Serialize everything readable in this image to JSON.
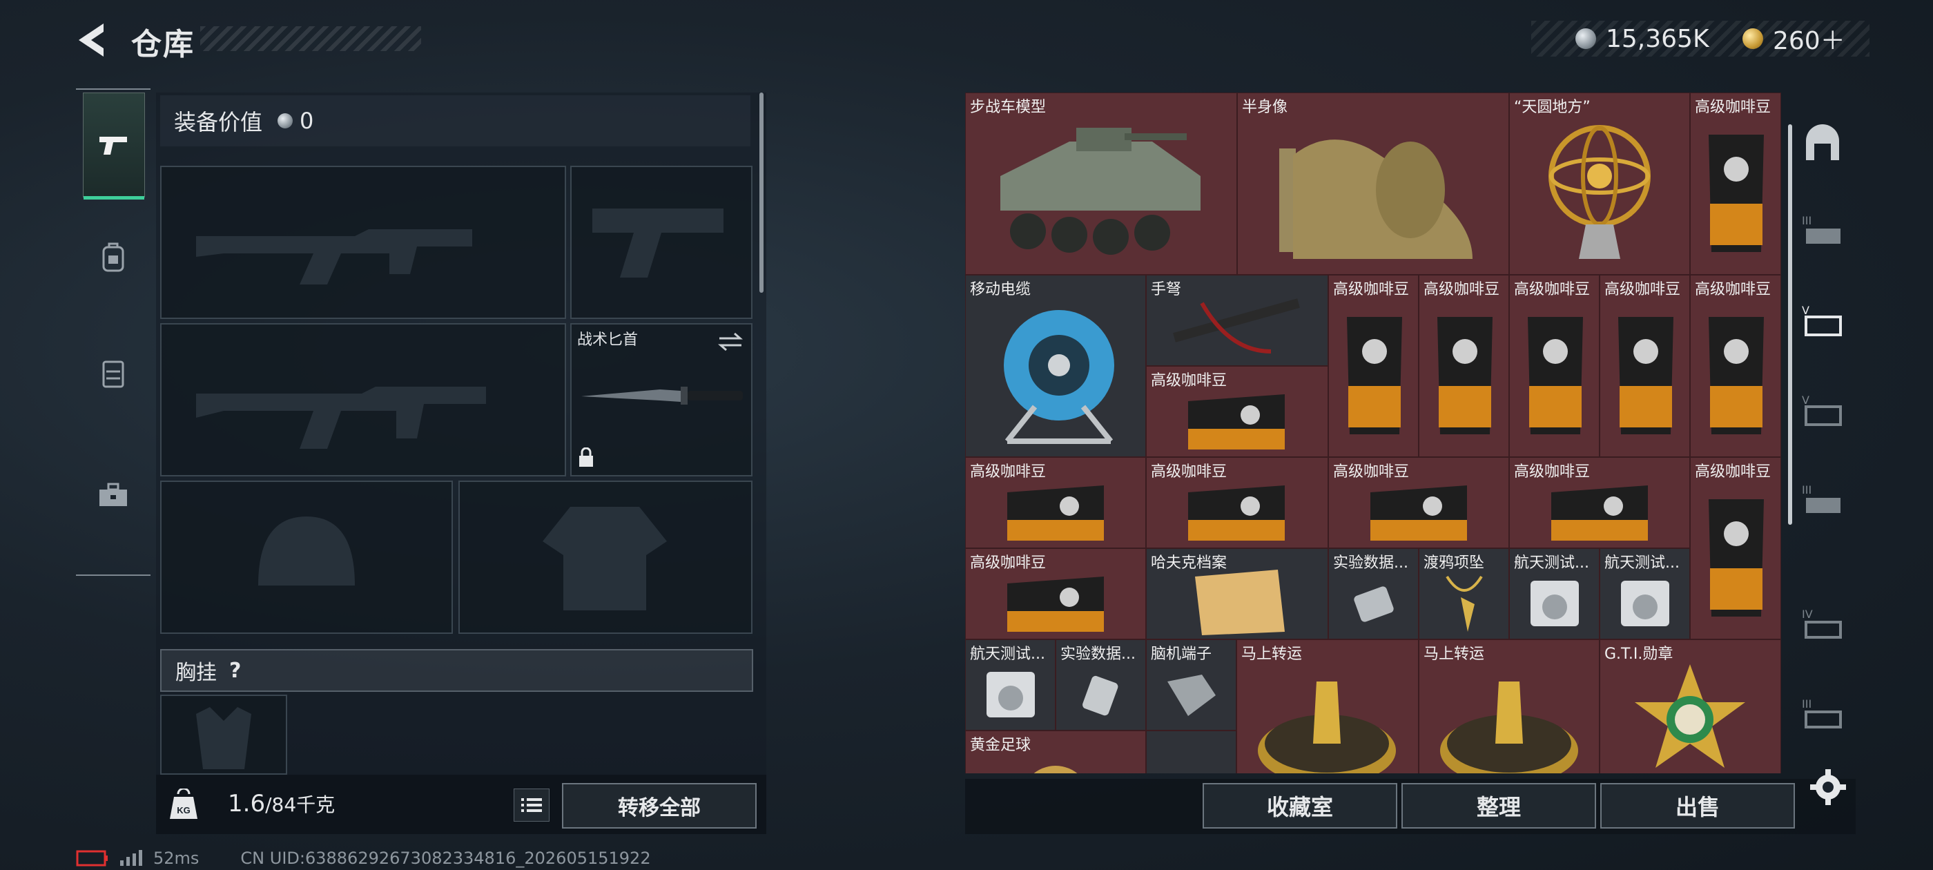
{
  "header": {
    "title": "仓库"
  },
  "currency": {
    "silver": "15,365K",
    "gold": "260＋"
  },
  "left_tabs": [
    "pistol-icon",
    "backpack-icon",
    "vest-icon",
    "toolbox-icon"
  ],
  "equipment": {
    "value_label": "装备价值",
    "value": "0",
    "knife_label": "战术匕首",
    "chest_label": "胸挂",
    "chest_help": "?"
  },
  "weight": {
    "current": "1.6",
    "max": "/84千克",
    "unit_icon": "KG"
  },
  "buttons": {
    "transfer_all": "转移全部",
    "collection": "收藏室",
    "organize": "整理",
    "sell": "出售"
  },
  "status": {
    "ping": "52ms",
    "uid": "CN UID:6388629267308233481​6_202605151922"
  },
  "grid_items": [
    "步战车模型",
    "半身像",
    "“天圆地方”",
    "高级咖啡豆",
    "移动电缆",
    "手弩",
    "高级咖啡豆",
    "高级咖啡豆",
    "高级咖啡豆",
    "高级咖啡豆",
    "高级咖啡豆",
    "高级咖啡豆",
    "高级咖啡豆",
    "高级咖啡豆",
    "高级咖啡豆",
    "高级咖啡豆",
    "高级咖啡豆",
    "高级咖啡豆",
    "哈夫克档案",
    "实验数据...",
    "渡鸦项坠",
    "航天测试...",
    "航天测试...",
    "航天测试...",
    "实验数据...",
    "脑机端子",
    "马上转运",
    "马上转运",
    "G.T.I.勋章",
    "黄金足球"
  ],
  "colors": {
    "accent": "#3ecf9a",
    "cell_red": "#5b2f34",
    "cell_gray": "#2f3238"
  }
}
